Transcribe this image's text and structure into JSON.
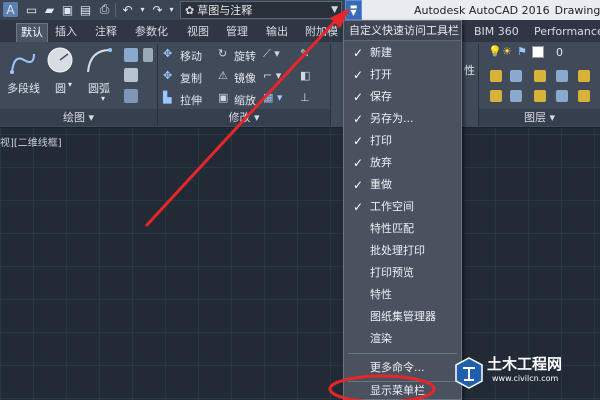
{
  "titlebar": {
    "workspace": "草图与注释",
    "app_name": "Autodesk AutoCAD 2016",
    "doc_name": "Drawing"
  },
  "tabs": [
    {
      "label": "默认",
      "active": true
    },
    {
      "label": "插入"
    },
    {
      "label": "注释"
    },
    {
      "label": "参数化"
    },
    {
      "label": "视图"
    },
    {
      "label": "管理"
    },
    {
      "label": "输出"
    },
    {
      "label": "附加模"
    },
    {
      "label": "BIM 360"
    },
    {
      "label": "Performance"
    }
  ],
  "ribbon": {
    "draw": {
      "polyline": "多段线",
      "circle": "圆",
      "arc": "圆弧",
      "footer": "绘图"
    },
    "modify": {
      "move": "移动",
      "rotate": "旋转",
      "copy": "复制",
      "mirror": "镜像",
      "stretch": "拉伸",
      "scale": "缩放",
      "footer": "修改"
    },
    "layers": {
      "footer": "图层",
      "layer_value": "0",
      "side_text": "性"
    }
  },
  "viewport_label": "视][二维线框]",
  "qa_menu": {
    "header": "自定义快速访问工具栏",
    "items": [
      {
        "label": "新建",
        "checked": true
      },
      {
        "label": "打开",
        "checked": true
      },
      {
        "label": "保存",
        "checked": true
      },
      {
        "label": "另存为...",
        "checked": true
      },
      {
        "label": "打印",
        "checked": true
      },
      {
        "label": "放弃",
        "checked": true
      },
      {
        "label": "重做",
        "checked": true
      },
      {
        "label": "工作空间",
        "checked": true
      },
      {
        "label": "特性匹配",
        "checked": false
      },
      {
        "label": "批处理打印",
        "checked": false
      },
      {
        "label": "打印预览",
        "checked": false
      },
      {
        "label": "特性",
        "checked": false
      },
      {
        "label": "图纸集管理器",
        "checked": false
      },
      {
        "label": "渲染",
        "checked": false
      }
    ],
    "more_commands": "更多命令...",
    "show_menubar": "显示菜单栏"
  },
  "watermark": {
    "text": "土木工程网",
    "url": "www.civilcn.com"
  },
  "colors": {
    "annotation": "#e8262a",
    "highlight_button": "#3a6cb6"
  }
}
